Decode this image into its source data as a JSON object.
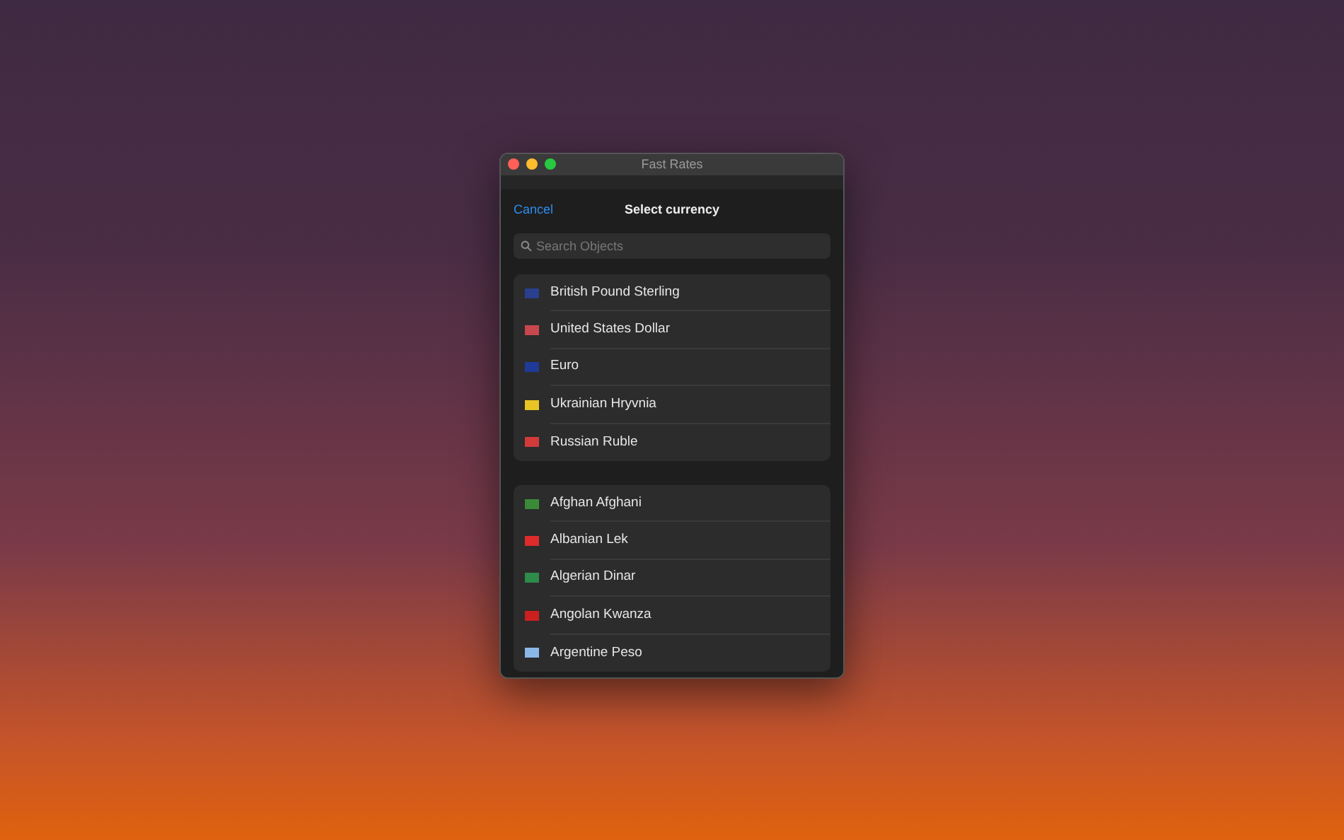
{
  "window": {
    "title": "Fast Rates"
  },
  "header": {
    "cancel": "Cancel",
    "title": "Select currency"
  },
  "search": {
    "placeholder": "Search Objects"
  },
  "groups": [
    {
      "items": [
        {
          "name": "British Pound Sterling",
          "color": "#2b3f8f"
        },
        {
          "name": "United States Dollar",
          "color": "#c8474e"
        },
        {
          "name": "Euro",
          "color": "#1f3a99"
        },
        {
          "name": "Ukrainian Hryvnia",
          "color": "#e8c524"
        },
        {
          "name": "Russian Ruble",
          "color": "#d33a3a"
        }
      ]
    },
    {
      "items": [
        {
          "name": "Afghan Afghani",
          "color": "#3a8a3a"
        },
        {
          "name": "Albanian Lek",
          "color": "#e02b2b"
        },
        {
          "name": "Algerian Dinar",
          "color": "#2e8b4a"
        },
        {
          "name": "Angolan Kwanza",
          "color": "#cc1f1f"
        },
        {
          "name": "Argentine Peso",
          "color": "#8ab8e6"
        }
      ]
    }
  ]
}
